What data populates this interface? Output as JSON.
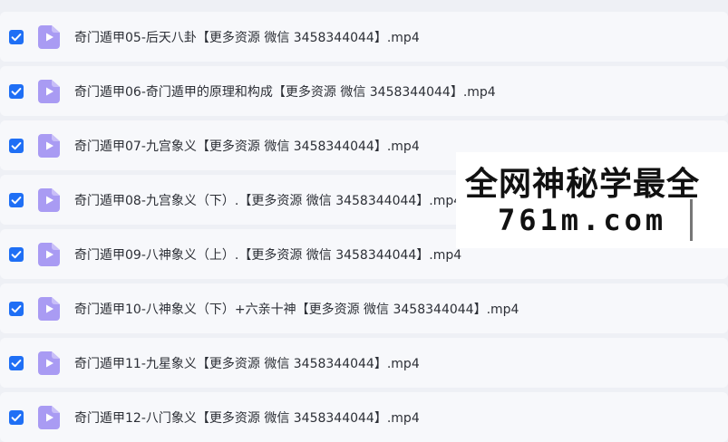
{
  "files": [
    {
      "name": "奇门遁甲05-后天八卦【更多资源 微信 3458344044】.mp4",
      "checked": true
    },
    {
      "name": "奇门遁甲06-奇门遁甲的原理和构成【更多资源 微信 3458344044】.mp4",
      "checked": true
    },
    {
      "name": "奇门遁甲07-九宫象义【更多资源 微信 3458344044】.mp4",
      "checked": true
    },
    {
      "name": "奇门遁甲08-九宫象义（下）.【更多资源 微信 3458344044】.mp4",
      "checked": true
    },
    {
      "name": "奇门遁甲09-八神象义（上）.【更多资源 微信 3458344044】.mp4",
      "checked": true
    },
    {
      "name": "奇门遁甲10-八神象义（下）+六亲十神【更多资源 微信 3458344044】.mp4",
      "checked": true
    },
    {
      "name": "奇门遁甲11-九星象义【更多资源 微信 3458344044】.mp4",
      "checked": true
    },
    {
      "name": "奇门遁甲12-八门象义【更多资源 微信 3458344044】.mp4",
      "checked": true
    }
  ],
  "watermark": {
    "line1": "全网神秘学最全",
    "line2": "761m.com"
  },
  "colors": {
    "checkbox": "#1f6ff5",
    "file_icon": "#a99bf3",
    "row_bg": "#f7f8fb",
    "page_bg": "#eef0f5"
  },
  "icons": {
    "checkbox": "checkmark-icon",
    "file": "video-file-icon"
  }
}
